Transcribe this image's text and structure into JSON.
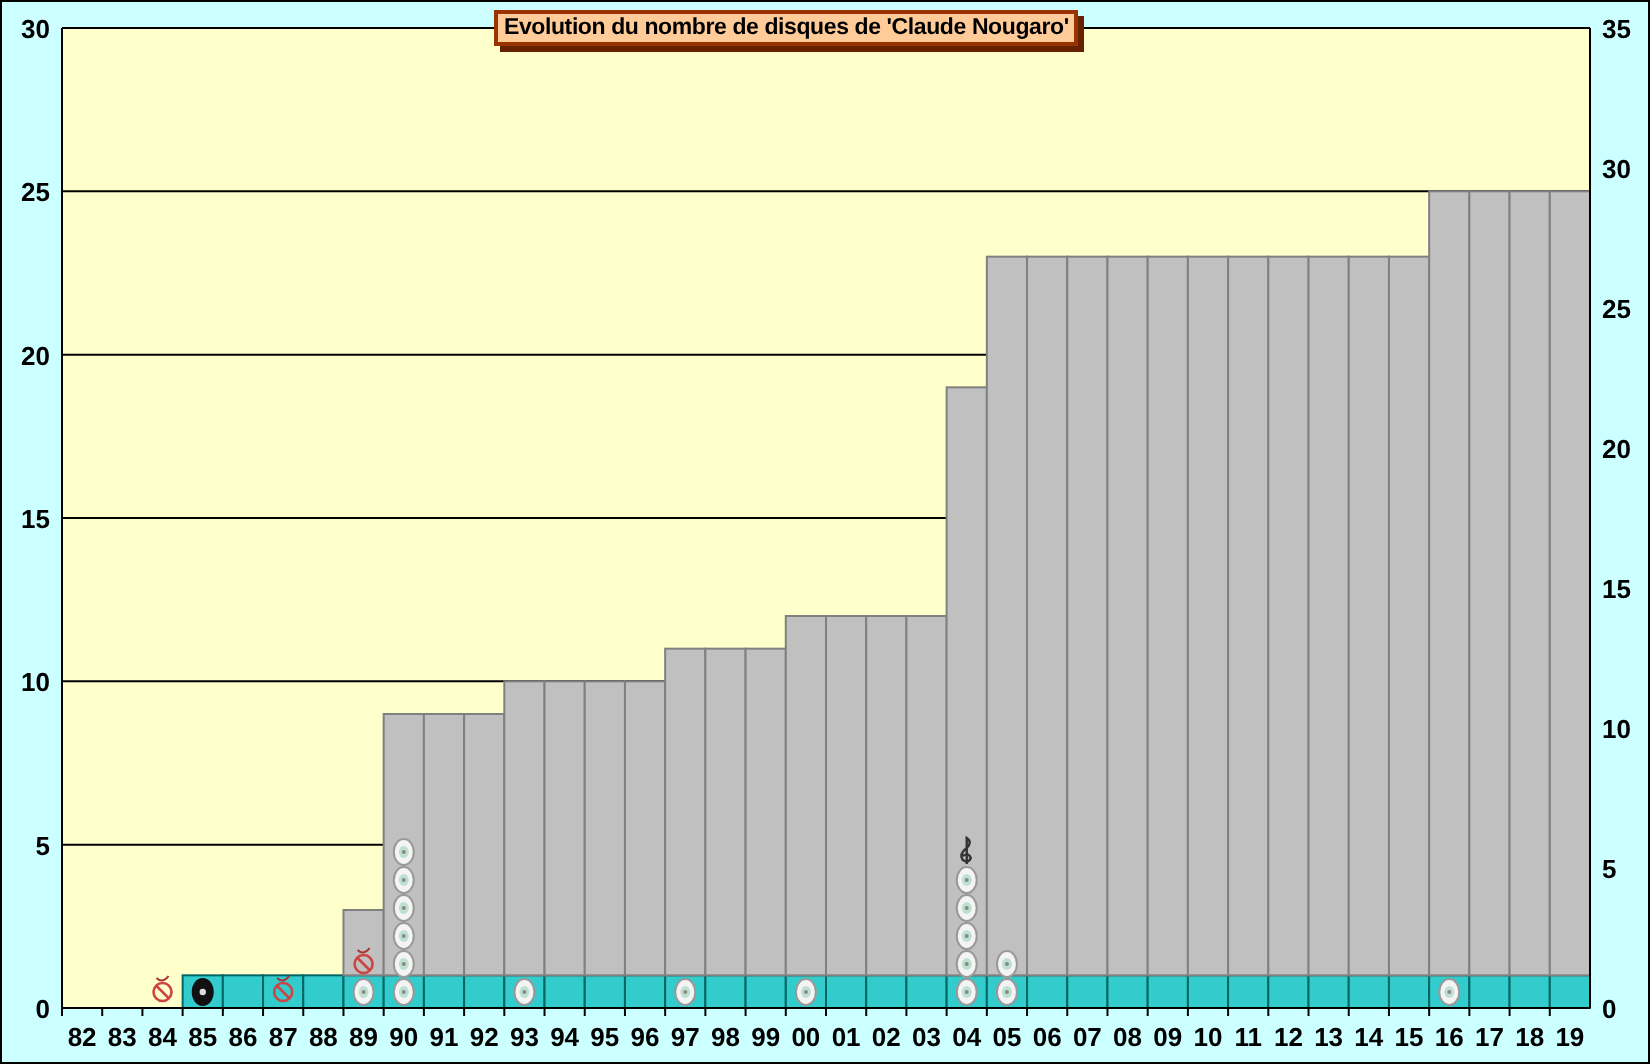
{
  "chart_data": {
    "type": "bar",
    "title": "Evolution du nombre de disques de 'Claude Nougaro'",
    "stacked": true,
    "grid": true,
    "categories": [
      "82",
      "83",
      "84",
      "85",
      "86",
      "87",
      "88",
      "89",
      "90",
      "91",
      "92",
      "93",
      "94",
      "95",
      "96",
      "97",
      "98",
      "99",
      "00",
      "01",
      "02",
      "03",
      "04",
      "05",
      "06",
      "07",
      "08",
      "09",
      "10",
      "11",
      "12",
      "13",
      "14",
      "15",
      "16",
      "17",
      "18",
      "19"
    ],
    "series": [
      {
        "color": "#33cccc",
        "values": [
          null,
          null,
          null,
          1,
          1,
          1,
          1,
          1,
          1,
          1,
          1,
          1,
          1,
          1,
          1,
          1,
          1,
          1,
          1,
          1,
          1,
          1,
          1,
          1,
          1,
          1,
          1,
          1,
          1,
          1,
          1,
          1,
          1,
          1,
          1,
          1,
          1,
          1
        ]
      },
      {
        "color": "#c0c0c0",
        "values": [
          null,
          null,
          null,
          null,
          null,
          null,
          null,
          2,
          8,
          8,
          8,
          9,
          9,
          9,
          9,
          10,
          10,
          10,
          11,
          11,
          11,
          11,
          18,
          22,
          22,
          22,
          22,
          22,
          22,
          22,
          22,
          22,
          22,
          22,
          24,
          24,
          24,
          24
        ]
      }
    ],
    "ylim": [
      0,
      30
    ],
    "yticks": [
      0,
      5,
      10,
      15,
      20,
      25,
      30
    ]
  },
  "right_axis": {
    "ticks": [
      "35",
      "30",
      "25",
      "20",
      "15",
      "10",
      "5",
      "0"
    ]
  },
  "columns": [
    {},
    {},
    {
      "icons": [
        {
          "kind": "prohibited"
        }
      ]
    },
    {
      "icons": [
        {
          "kind": "vinyl"
        }
      ]
    },
    {},
    {
      "icons": [
        {
          "kind": "prohibited"
        }
      ]
    },
    {},
    {
      "icons": [
        {
          "kind": "disc"
        },
        {
          "kind": "prohibited"
        }
      ]
    },
    {
      "icons": [
        {
          "kind": "disc"
        },
        {
          "kind": "disc"
        },
        {
          "kind": "disc"
        },
        {
          "kind": "disc"
        },
        {
          "kind": "disc"
        },
        {
          "kind": "disc"
        }
      ]
    },
    {},
    {},
    {
      "icons": [
        {
          "kind": "disc"
        }
      ]
    },
    {},
    {},
    {},
    {
      "icons": [
        {
          "kind": "disc"
        }
      ]
    },
    {},
    {},
    {
      "icons": [
        {
          "kind": "disc"
        }
      ]
    },
    {},
    {},
    {},
    {
      "icons": [
        {
          "kind": "disc"
        },
        {
          "kind": "disc"
        },
        {
          "kind": "disc"
        },
        {
          "kind": "disc"
        },
        {
          "kind": "disc"
        },
        {
          "kind": "clef"
        }
      ]
    },
    {
      "icons": [
        {
          "kind": "disc"
        },
        {
          "kind": "disc"
        }
      ]
    },
    {},
    {},
    {},
    {},
    {},
    {},
    {},
    {},
    {},
    {},
    {
      "icons": [
        {
          "kind": "disc"
        }
      ]
    },
    {},
    {},
    {}
  ]
}
